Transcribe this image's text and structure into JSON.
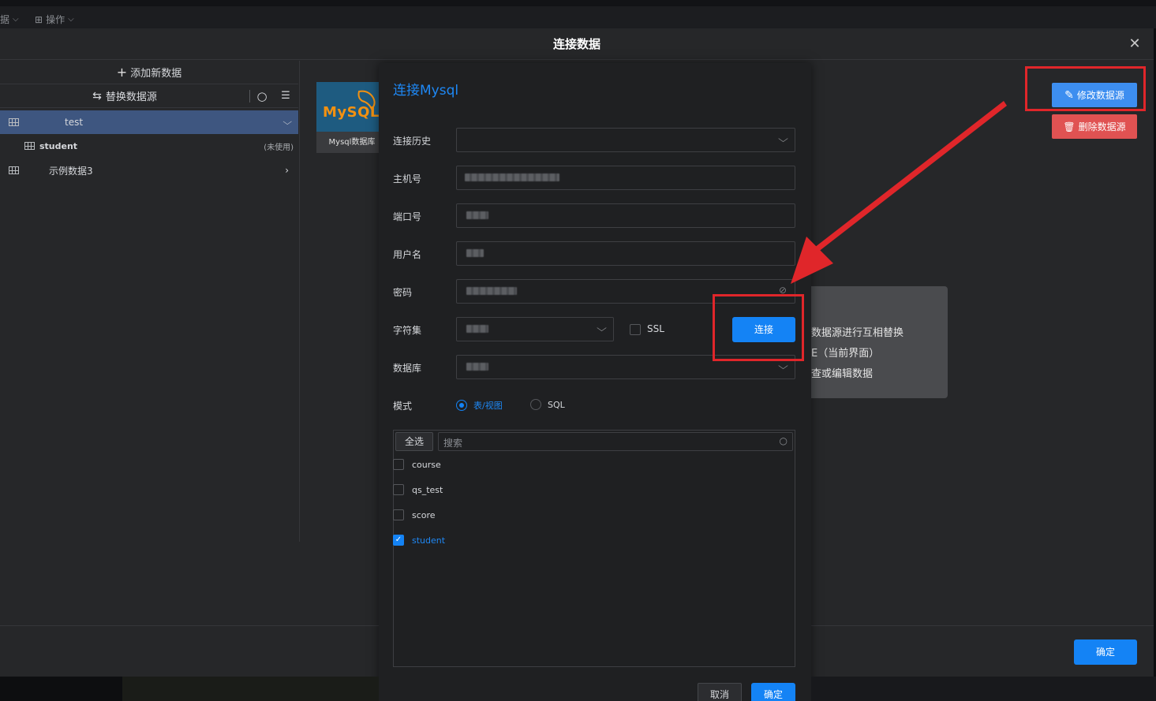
{
  "topbar": {
    "menu_left": "据",
    "menu_ops": "操作"
  },
  "dialog": {
    "title": "连接数据",
    "footer_confirm": "确定"
  },
  "left_panel": {
    "add_new": "添加新数据",
    "replace_source": "替换数据源",
    "items": [
      {
        "label": "test",
        "selected": true,
        "expanded": true
      },
      {
        "label": "student",
        "note": "(未使用)",
        "child": true
      },
      {
        "label": "示例数据3",
        "expanded": false
      }
    ]
  },
  "mysql_card": {
    "logo_text": "MySQL",
    "caption": "Mysql数据库"
  },
  "right_actions": {
    "edit": "修改数据源",
    "delete": "删除数据源"
  },
  "tooltip_lines": [
    "数据源进行互相替换",
    "E（当前界面）",
    "查或编辑数据"
  ],
  "connect_form": {
    "title": "连接Mysql",
    "fields": {
      "history": "连接历史",
      "host": "主机号",
      "port": "端口号",
      "user": "用户名",
      "password": "密码",
      "charset": "字符集",
      "database": "数据库",
      "mode": "模式"
    },
    "ssl_label": "SSL",
    "connect_button": "连接",
    "mode_options": [
      {
        "label": "表/视图",
        "selected": true
      },
      {
        "label": "SQL",
        "selected": false
      }
    ],
    "select_all": "全选",
    "search_placeholder": "搜索",
    "tables": [
      {
        "name": "course",
        "checked": false
      },
      {
        "name": "qs_test",
        "checked": false
      },
      {
        "name": "score",
        "checked": false
      },
      {
        "name": "student",
        "checked": true
      }
    ],
    "cancel": "取消",
    "confirm": "确定"
  },
  "colors": {
    "accent": "#1483f5",
    "danger": "#e05252",
    "highlight": "#e0262a"
  }
}
